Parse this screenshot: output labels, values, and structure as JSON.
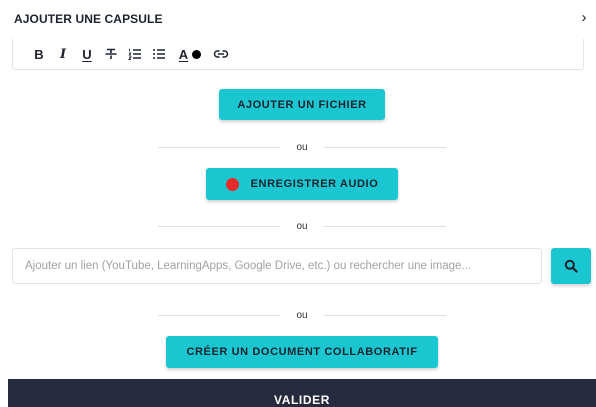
{
  "header": {
    "title": "AJOUTER UNE CAPSULE",
    "close_glyph": "›"
  },
  "toolbar": {
    "bold": "B",
    "italic": "I",
    "underline": "U",
    "text_color": "A",
    "icons": [
      "bold-icon",
      "italic-icon",
      "underline-icon",
      "strikethrough-icon",
      "ordered-list-icon",
      "bullet-list-icon",
      "text-color-icon",
      "link-icon"
    ]
  },
  "actions": {
    "add_file": "AJOUTER UN FICHIER",
    "or": "ou",
    "record_audio": "ENREGISTRER AUDIO",
    "create_collab_doc": "CRÉER UN DOCUMENT COLLABORATIF"
  },
  "search": {
    "value": "",
    "placeholder": "Ajouter un lien (YouTube, LearningApps, Google Drive, etc.) ou rechercher une image..."
  },
  "footer": {
    "validate": "VALIDER"
  },
  "colors": {
    "accent": "#1ac6cf",
    "record": "#ee2b2b",
    "footer_bg": "#242b3c",
    "text": "#1f2330"
  }
}
